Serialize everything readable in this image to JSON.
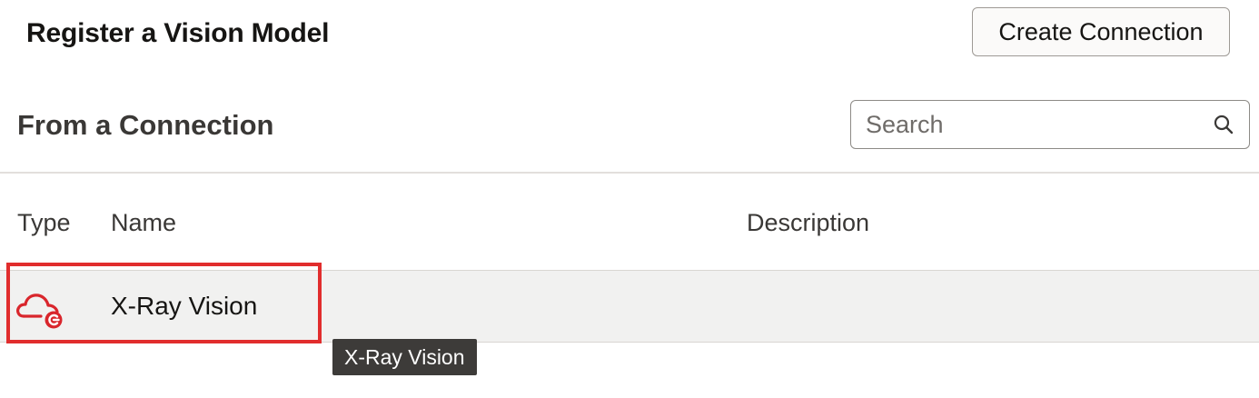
{
  "header": {
    "title": "Register a Vision Model",
    "create_button_label": "Create Connection"
  },
  "section": {
    "title": "From a Connection"
  },
  "search": {
    "placeholder": "Search",
    "value": "",
    "icon": "search-icon"
  },
  "table": {
    "columns": [
      "Type",
      "Name",
      "Description"
    ],
    "rows": [
      {
        "type_icon": "cloud-connection-icon",
        "name": "X-Ray Vision",
        "description": ""
      }
    ]
  },
  "tooltip": {
    "text": "X-Ray Vision"
  },
  "colors": {
    "accent_red": "#e12d2d",
    "icon_red": "#d9262c",
    "row_background": "#f1f1f0",
    "tooltip_background": "#3d3b39"
  }
}
